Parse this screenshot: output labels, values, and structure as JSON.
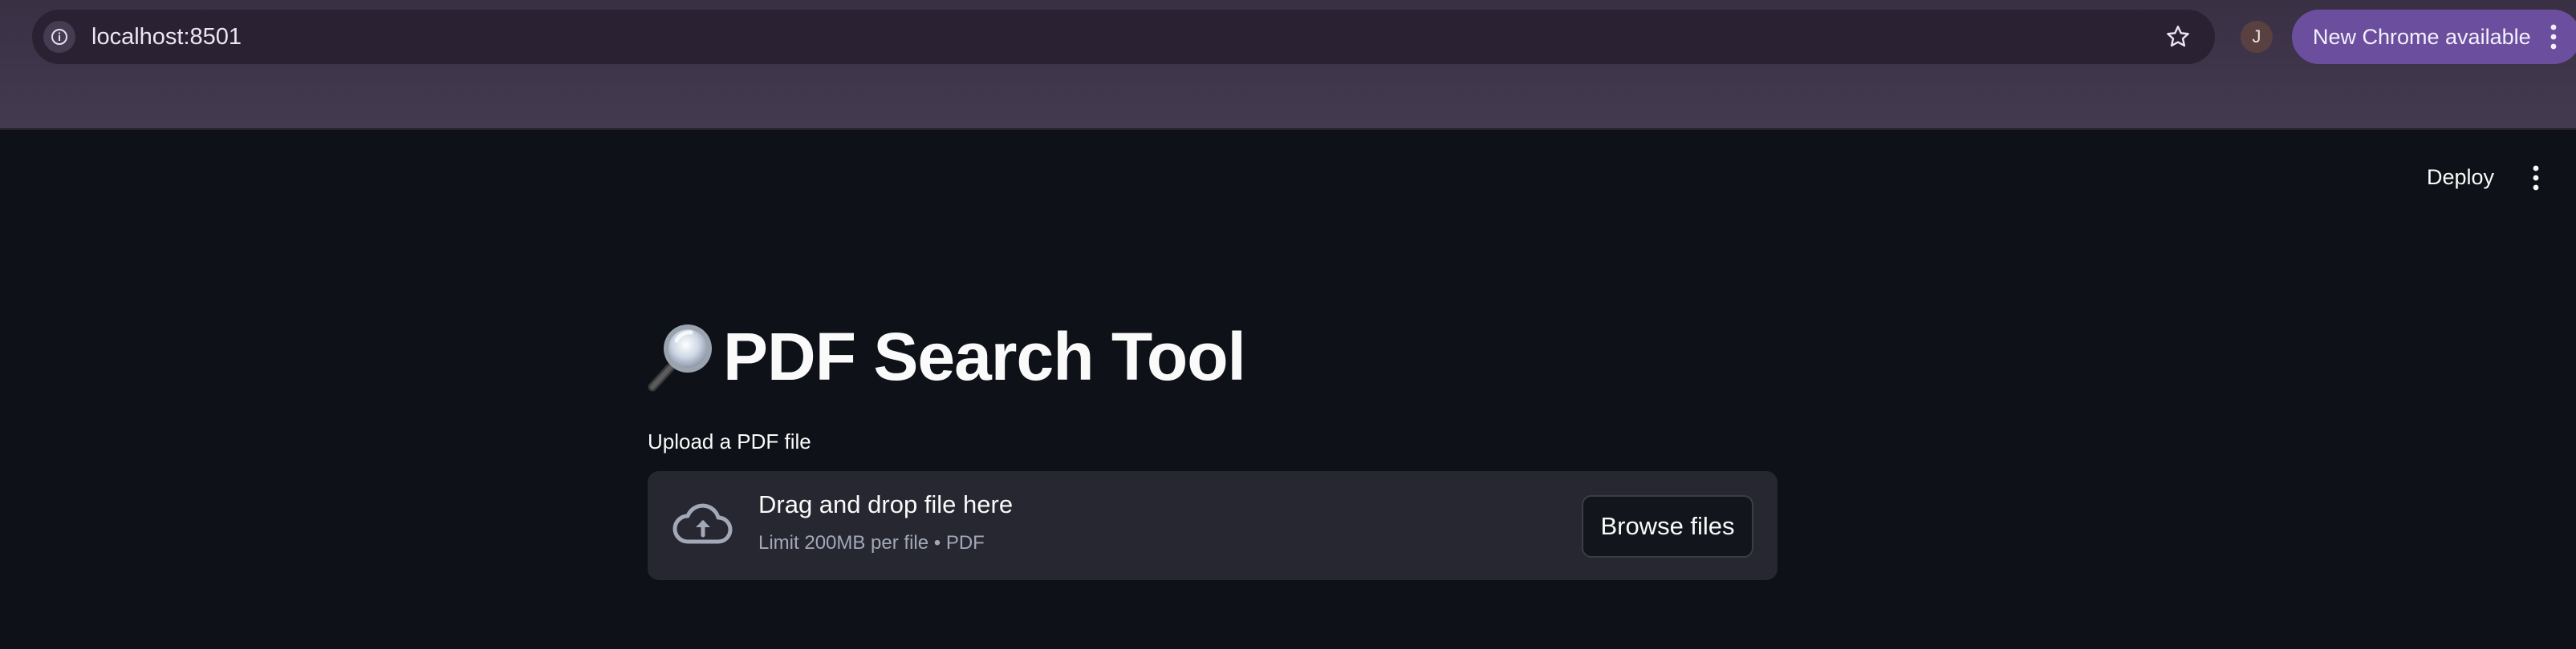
{
  "browser": {
    "url": "localhost:8501",
    "profile_initial": "J",
    "update_label": "New Chrome available"
  },
  "header": {
    "deploy_label": "Deploy"
  },
  "main": {
    "title": "PDF Search Tool",
    "title_icon": "magnifying-glass-emoji",
    "uploader": {
      "label": "Upload a PDF file",
      "drop_text": "Drag and drop file here",
      "limit_text": "Limit 200MB per file • PDF",
      "browse_label": "Browse files",
      "icon": "cloud-upload-icon"
    }
  },
  "colors": {
    "background": "#0e1117",
    "chrome": "#3a3044",
    "update_chip": "#6b4f9e",
    "dropzone": "#262730"
  }
}
